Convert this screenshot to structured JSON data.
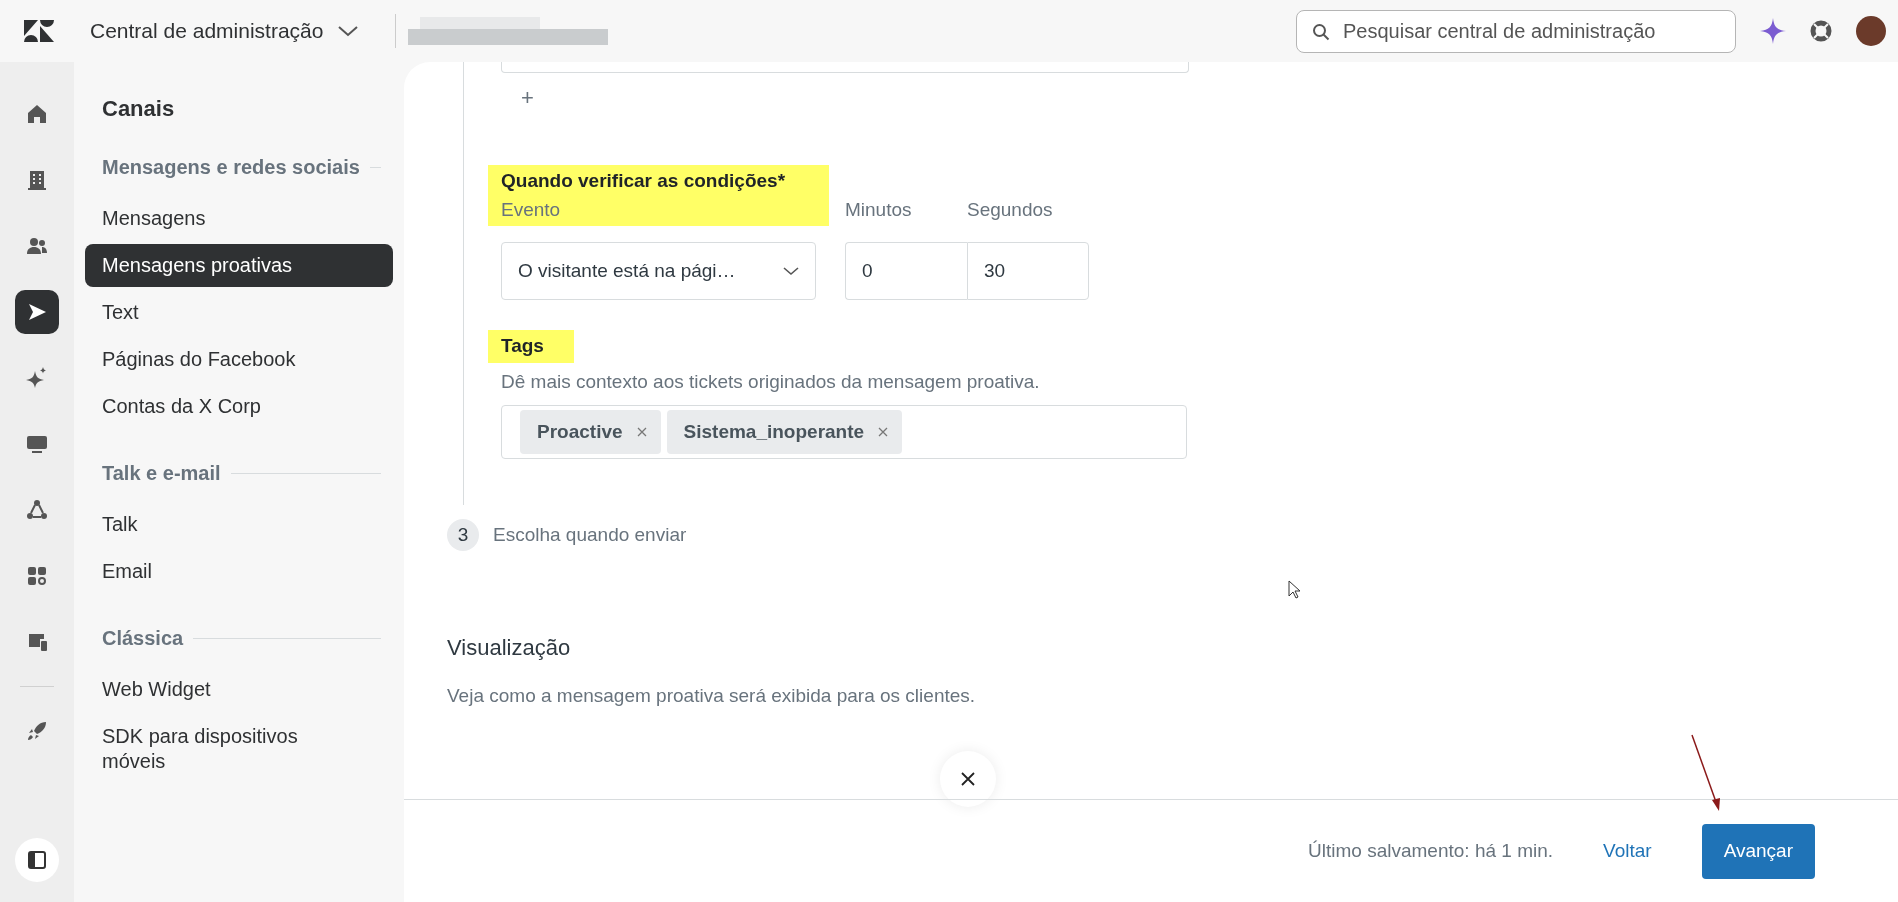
{
  "topbar": {
    "product_title": "Central de administração",
    "search": {
      "placeholder": "Pesquisar central de administração"
    }
  },
  "rail": {
    "items": [
      {
        "kind": "home",
        "selected": false
      },
      {
        "kind": "building",
        "selected": false
      },
      {
        "kind": "people",
        "selected": false
      },
      {
        "kind": "send",
        "selected": true
      },
      {
        "kind": "sparkle",
        "selected": false
      },
      {
        "kind": "monitor",
        "selected": false
      },
      {
        "kind": "nodes",
        "selected": false
      },
      {
        "kind": "apps",
        "selected": false
      },
      {
        "kind": "devices",
        "selected": false
      }
    ],
    "bottom_items": [
      {
        "kind": "rocket",
        "selected": false
      }
    ]
  },
  "nav": {
    "title": "Canais",
    "sections": [
      {
        "title": "Mensagens e redes sociais",
        "items": [
          {
            "label": "Mensagens",
            "selected": false
          },
          {
            "label": "Mensagens proativas",
            "selected": true
          },
          {
            "label": "Text",
            "selected": false
          },
          {
            "label": "Páginas do Facebook",
            "selected": false
          },
          {
            "label": "Contas da X Corp",
            "selected": false
          }
        ]
      },
      {
        "title": "Talk e e-mail",
        "items": [
          {
            "label": "Talk",
            "selected": false
          },
          {
            "label": "Email",
            "selected": false
          }
        ]
      },
      {
        "title": "Clássica",
        "items": [
          {
            "label": "Web Widget",
            "selected": false
          },
          {
            "label": "SDK para dispositivos móveis",
            "selected": false
          }
        ]
      }
    ]
  },
  "form": {
    "add_button": "+",
    "conditions": {
      "title": "Quando verificar as condições*",
      "highlighted": true,
      "event": {
        "label": "Evento",
        "value": "O visitante está na pági…"
      },
      "minutes": {
        "label": "Minutos",
        "value": "0"
      },
      "seconds": {
        "label": "Segundos",
        "value": "30"
      }
    },
    "tags": {
      "title": "Tags",
      "highlighted": true,
      "description": "Dê mais contexto aos tickets originados da mensagem proativa.",
      "items": [
        "Proactive",
        "Sistema_inoperante"
      ]
    },
    "step": {
      "number": "3",
      "label": "Escolha quando enviar"
    }
  },
  "preview": {
    "title": "Visualização",
    "description": "Veja como a mensagem proativa será exibida para os clientes."
  },
  "footer": {
    "last_saved": "Último salvamento: há 1 min.",
    "back": "Voltar",
    "next": "Avançar"
  }
}
